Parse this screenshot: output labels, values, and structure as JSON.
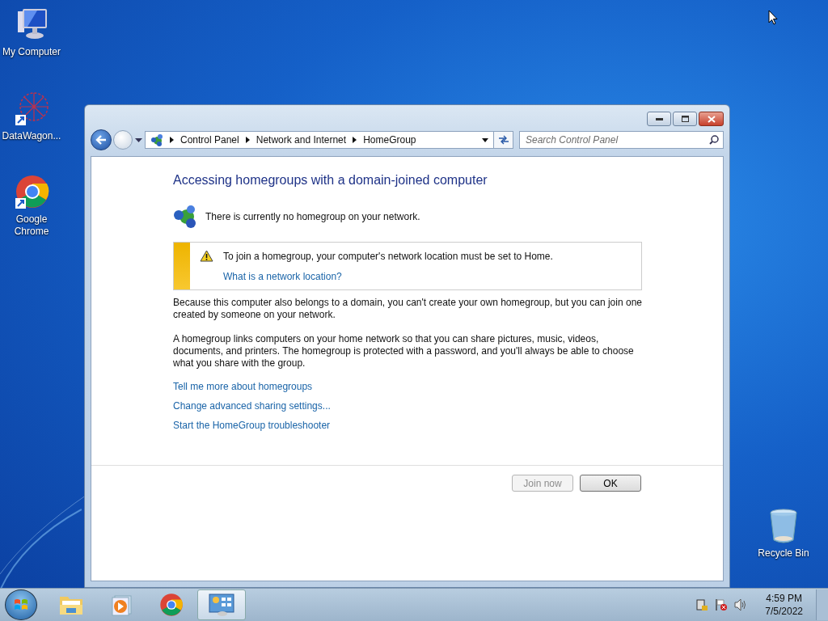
{
  "desktop_icons": [
    {
      "label": "My Computer",
      "kind": "computer"
    },
    {
      "label": "DataWagon...",
      "kind": "app"
    },
    {
      "label": "Google Chrome",
      "kind": "chrome"
    },
    {
      "label": "Recycle Bin",
      "kind": "recycle"
    }
  ],
  "window": {
    "breadcrumb": [
      "Control Panel",
      "Network and Internet",
      "HomeGroup"
    ],
    "search": {
      "placeholder": "Search Control Panel"
    },
    "heading": "Accessing homegroups with a domain-joined computer",
    "status": "There is currently no homegroup on your network.",
    "warning": {
      "text": "To join a homegroup, your computer's network location must be set to Home.",
      "link": "What is a network location?"
    },
    "paragraphs": [
      "Because this computer also belongs to a domain, you can't create your own homegroup, but you can join one created by someone on your network.",
      "A homegroup links computers on your home network so that you can share pictures, music, videos, documents, and printers. The homegroup is protected with a password, and you'll always be able to choose what you share with the group."
    ],
    "links": [
      "Tell me more about homegroups",
      "Change advanced sharing settings...",
      "Start the HomeGroup troubleshooter"
    ],
    "buttons": [
      {
        "label": "Join now",
        "disabled": true
      },
      {
        "label": "OK",
        "disabled": false
      }
    ]
  },
  "taskbar": {
    "items": [
      {
        "kind": "explorer",
        "selected": false
      },
      {
        "kind": "media",
        "selected": false
      },
      {
        "kind": "chrome",
        "selected": false
      },
      {
        "kind": "control-panel",
        "selected": true
      }
    ],
    "clock": {
      "time": "4:59 PM",
      "date": "7/5/2022"
    }
  }
}
